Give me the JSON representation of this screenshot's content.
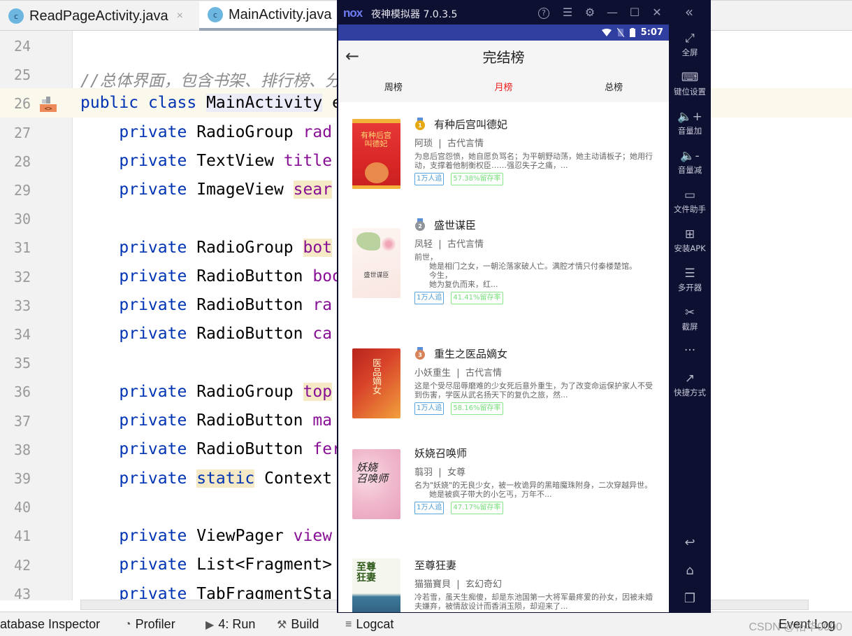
{
  "ide": {
    "tabs": [
      {
        "label": "ReadPageActivity.java",
        "icon": "class-icon",
        "icon_letter": "c",
        "close": "×",
        "active": false
      },
      {
        "label": "MainActivity.java",
        "icon": "class-icon",
        "icon_letter": "c",
        "active": true
      }
    ],
    "lines": [
      {
        "num": "24"
      },
      {
        "num": "25"
      },
      {
        "num": "26"
      },
      {
        "num": "27"
      },
      {
        "num": "28"
      },
      {
        "num": "29"
      },
      {
        "num": "30"
      },
      {
        "num": "31"
      },
      {
        "num": "32"
      },
      {
        "num": "33"
      },
      {
        "num": "34"
      },
      {
        "num": "35"
      },
      {
        "num": "36"
      },
      {
        "num": "37"
      },
      {
        "num": "38"
      },
      {
        "num": "39"
      },
      {
        "num": "40"
      },
      {
        "num": "41"
      },
      {
        "num": "42"
      },
      {
        "num": "43"
      }
    ],
    "code": {
      "l25_comment": "//总体界面，包含书架、排行榜、分类",
      "kw_public": "public",
      "kw_class": "class",
      "kw_private": "private",
      "kw_static": "static",
      "class_name": "MainActivity",
      "class_tail": " e",
      "l27_type": "RadioGroup",
      "l27_field": "rad",
      "l28_type": "TextView",
      "l28_field": "title",
      "l29_type": "ImageView",
      "l29_field": "sear",
      "l31_type": "RadioGroup",
      "l31_field": "bot",
      "l32_type": "RadioButton",
      "l32_field": "boo",
      "l33_type": "RadioButton",
      "l33_field": "ra",
      "l34_type": "RadioButton",
      "l34_field": "ca",
      "l36_type": "RadioGroup",
      "l36_field": "top",
      "l37_type": "RadioButton",
      "l37_field": "ma",
      "l38_type": "RadioButton",
      "l38_field": "fer",
      "l39_type": "Context",
      "l41_type": "ViewPager",
      "l41_field": "view",
      "l42_type": "List<Fragment>",
      "l43_type": "TabFragmentSta"
    },
    "statusbar": {
      "database": "atabase Inspector",
      "profiler": "Profiler",
      "run": "4: Run",
      "build": "Build",
      "logcat": "Logcat",
      "event_log": "Event Log",
      "watermark": "CSDN @柘华0000"
    }
  },
  "emulator": {
    "logo": "nox",
    "title": "夜神模拟器 7.0.3.5",
    "controls": {
      "help": "?",
      "menu": "☰",
      "settings": "⚙",
      "minimize": "—",
      "maximize": "☐",
      "close": "✕",
      "collapse": "«"
    },
    "phone_status": {
      "time": "5:07"
    },
    "app": {
      "title": "完结榜",
      "back": "←",
      "tabs": [
        {
          "label": "周榜",
          "active": false
        },
        {
          "label": "月榜",
          "active": true
        },
        {
          "label": "总榜",
          "active": false
        }
      ],
      "books": [
        {
          "rank": "1",
          "medal": "gold",
          "title": "有种后宫叫德妃",
          "author": "阿琐",
          "category": "古代言情",
          "desc": "为息后宫怨愤，她自愿负骂名；为平朝野动荡，她主动请板子；她用行动，支撑着他制衡权臣……强忍失子之痛，...",
          "followers": "1万人追",
          "retention": "57.38%留存率",
          "cover_text": "有种后宫\n叫德妃"
        },
        {
          "rank": "2",
          "medal": "silver",
          "title": "盛世谋臣",
          "author": "凤轻",
          "category": "古代言情",
          "desc": "前世，\n      她是相门之女，一朝沦落家破人亡。满腔才情只付秦楼楚馆。\n      今生，\n      她为复仇而来，红...",
          "followers": "1万人追",
          "retention": "41.41%留存率",
          "cover_text": "盛世谋臣"
        },
        {
          "rank": "3",
          "medal": "bronze",
          "title": "重生之医品嫡女",
          "author": "小妖重生",
          "category": "古代言情",
          "desc": "这是个受尽屈辱磨难的少女死后意外重生，为了改变命运保护家人不受到伤害，学医从武名扬天下的复仇之旅，然...",
          "followers": "1万人追",
          "retention": "58.16%留存率",
          "cover_text": "医品嫡女"
        },
        {
          "rank": "",
          "medal": "none",
          "title": "妖娆召唤师",
          "author": "翦羽",
          "category": "女尊",
          "desc": "名为\"妖娆\"的无良少女，被一枚诡异的黑暗魔珠附身，二次穿越异世。\n      她是被疯子带大的小乞丐，万年不...",
          "followers": "1万人追",
          "retention": "47.17%留存率",
          "cover_text": "妖娆\n召唤师"
        },
        {
          "rank": "",
          "medal": "none",
          "title": "至尊狂妻",
          "author": "猫猫寶貝",
          "category": "玄幻奇幻",
          "desc": "冷若雪，虽天生痴傻，却是东池国第一大将军最疼爱的孙女，因被未婚夫嫌弃，被情敌设计而香消玉陨，却迎来了...",
          "followers": "",
          "retention": "",
          "cover_text": "至尊\n狂妻"
        }
      ]
    },
    "sidebar": [
      {
        "label": "全屏",
        "icon": "fullscreen-icon",
        "glyph": "⤢"
      },
      {
        "label": "键位设置",
        "icon": "keyboard-icon",
        "glyph": "⌨"
      },
      {
        "label": "音量加",
        "icon": "volume-up-icon",
        "glyph": "🔈+"
      },
      {
        "label": "音量减",
        "icon": "volume-down-icon",
        "glyph": "🔈-"
      },
      {
        "label": "文件助手",
        "icon": "file-assistant-icon",
        "glyph": "▭"
      },
      {
        "label": "安装APK",
        "icon": "install-apk-icon",
        "glyph": "⊞"
      },
      {
        "label": "多开器",
        "icon": "multi-instance-icon",
        "glyph": "☰"
      },
      {
        "label": "截屏",
        "icon": "screenshot-icon",
        "glyph": "✂"
      },
      {
        "label": "",
        "icon": "more-icon",
        "glyph": "···"
      },
      {
        "label": "快捷方式",
        "icon": "shortcut-icon",
        "glyph": "↗"
      }
    ],
    "nav": {
      "back": "↩",
      "home": "⌂",
      "recent": "❐"
    }
  }
}
